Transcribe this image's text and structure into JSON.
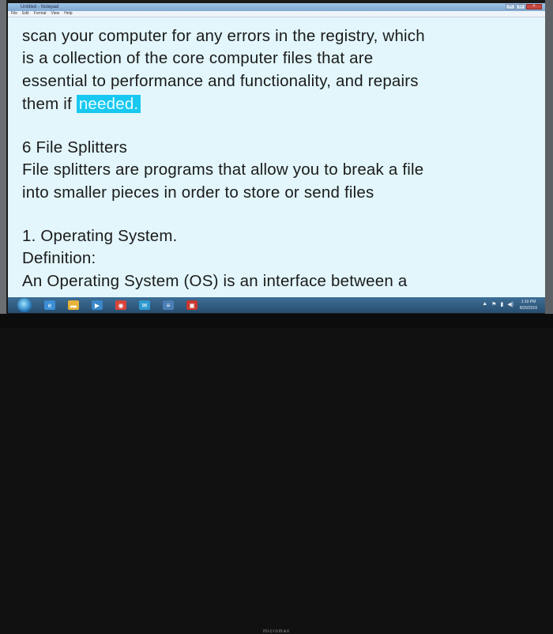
{
  "window": {
    "title": "Untitled - Notepad"
  },
  "menu": [
    "File",
    "Edit",
    "Format",
    "View",
    "Help"
  ],
  "document": {
    "lines": [
      "scan your computer for any errors in the registry, which",
      "is a collection of the core computer files that are",
      "essential to performance and functionality, and repairs",
      "them if ",
      "",
      "6 File Splitters",
      "File splitters are programs that allow you to break a file",
      "into smaller pieces in order to store or send files",
      "",
      "1. Operating System.",
      "Definition:",
      "An Operating System (OS) is an interface between a"
    ],
    "selected_word": "needed."
  },
  "taskbar": {
    "clock_time": "1:10 PM",
    "clock_date": "8/20/2016"
  },
  "monitor": {
    "brand": "micromax"
  },
  "colors": {
    "doc_background": "#e2f6fb",
    "selection": "#19c8f0",
    "taskbar": "#264d6f"
  }
}
